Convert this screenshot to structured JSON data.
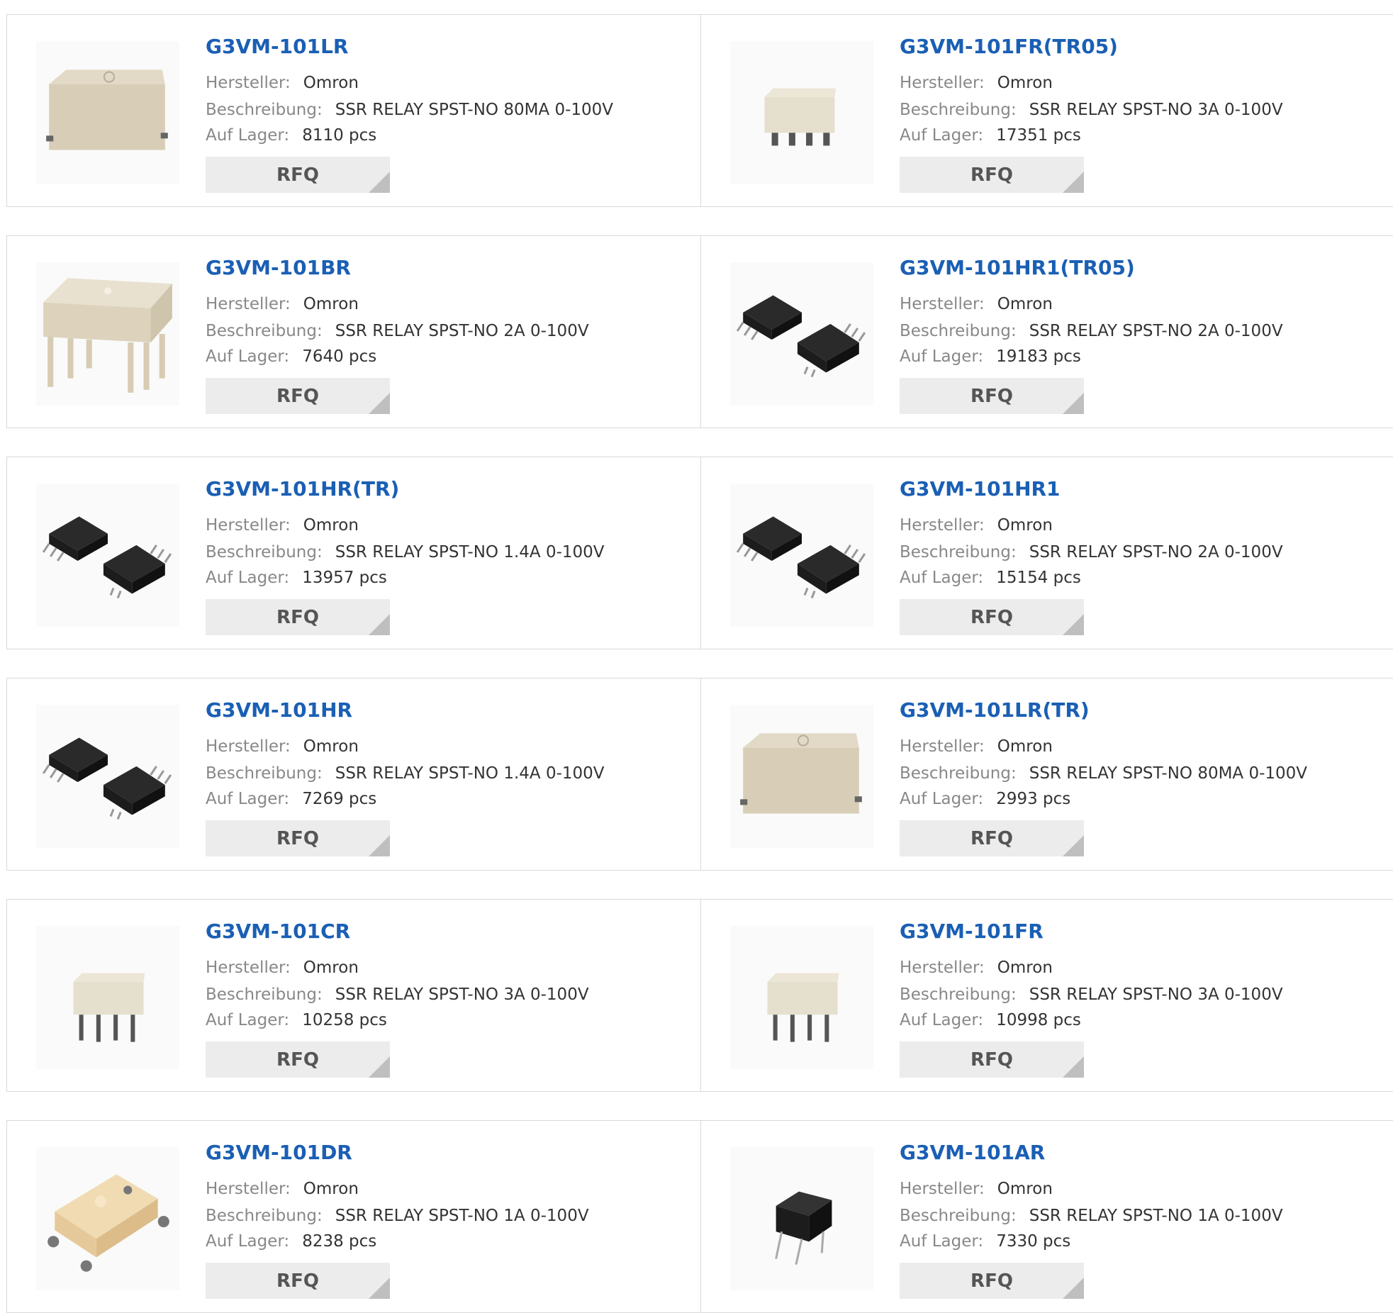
{
  "labels": {
    "manufacturer": "Hersteller:",
    "description": "Beschreibung:",
    "stock": "Auf Lager:",
    "rfq": "RFQ"
  },
  "colors": {
    "part_link": "#1a5fb4",
    "label": "#888888",
    "border": "#d9d9d9",
    "rfq_bg": "#ececec"
  },
  "products": [
    {
      "part": "G3VM-101LR",
      "manufacturer": "Omron",
      "description": "SSR RELAY SPST-NO 80MA 0-100V",
      "stock": "8110 pcs",
      "image": "beige-smd-box"
    },
    {
      "part": "G3VM-101FR(TR05)",
      "manufacturer": "Omron",
      "description": "SSR RELAY SPST-NO 3A 0-100V",
      "stock": "17351 pcs",
      "image": "white-smd-8pin"
    },
    {
      "part": "G3VM-101BR",
      "manufacturer": "Omron",
      "description": "SSR RELAY SPST-NO 2A 0-100V",
      "stock": "7640 pcs",
      "image": "beige-dip-6pin"
    },
    {
      "part": "G3VM-101HR1(TR05)",
      "manufacturer": "Omron",
      "description": "SSR RELAY SPST-NO 2A 0-100V",
      "stock": "19183 pcs",
      "image": "black-smd-pair"
    },
    {
      "part": "G3VM-101HR(TR)",
      "manufacturer": "Omron",
      "description": "SSR RELAY SPST-NO 1.4A 0-100V",
      "stock": "13957 pcs",
      "image": "black-smd-pair"
    },
    {
      "part": "G3VM-101HR1",
      "manufacturer": "Omron",
      "description": "SSR RELAY SPST-NO 2A 0-100V",
      "stock": "15154 pcs",
      "image": "black-smd-pair"
    },
    {
      "part": "G3VM-101HR",
      "manufacturer": "Omron",
      "description": "SSR RELAY SPST-NO 1.4A 0-100V",
      "stock": "7269 pcs",
      "image": "black-smd-pair"
    },
    {
      "part": "G3VM-101LR(TR)",
      "manufacturer": "Omron",
      "description": "SSR RELAY SPST-NO 80MA 0-100V",
      "stock": "2993 pcs",
      "image": "beige-smd-box"
    },
    {
      "part": "G3VM-101CR",
      "manufacturer": "Omron",
      "description": "SSR RELAY SPST-NO 3A 0-100V",
      "stock": "10258 pcs",
      "image": "white-dip-8pin"
    },
    {
      "part": "G3VM-101FR",
      "manufacturer": "Omron",
      "description": "SSR RELAY SPST-NO 3A 0-100V",
      "stock": "10998 pcs",
      "image": "white-dip-8pin"
    },
    {
      "part": "G3VM-101DR",
      "manufacturer": "Omron",
      "description": "SSR RELAY SPST-NO 1A 0-100V",
      "stock": "8238 pcs",
      "image": "cream-smd-4pin"
    },
    {
      "part": "G3VM-101AR",
      "manufacturer": "Omron",
      "description": "SSR RELAY SPST-NO 1A 0-100V",
      "stock": "7330 pcs",
      "image": "black-dip-4pin"
    }
  ]
}
